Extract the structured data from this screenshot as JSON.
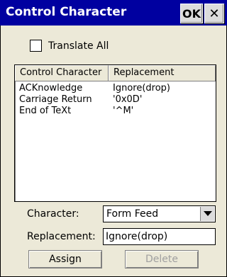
{
  "window": {
    "title": "Control Character",
    "ok_label": "OK",
    "close_glyph": "✕"
  },
  "translate_all": {
    "label": "Translate All",
    "checked": false
  },
  "list": {
    "headers": [
      "Control Character",
      "Replacement"
    ],
    "rows": [
      {
        "character": "ACKnowledge",
        "replacement": "Ignore(drop)"
      },
      {
        "character": "Carriage Return",
        "replacement": "'0x0D'"
      },
      {
        "character": "End of TeXt",
        "replacement": "'^M'"
      }
    ]
  },
  "character_field": {
    "label": "Character:",
    "value": "Form Feed"
  },
  "replacement_field": {
    "label": "Replacement:",
    "value": "Ignore(drop)"
  },
  "buttons": {
    "assign": "Assign",
    "delete": "Delete"
  },
  "colors": {
    "titlebar": "#0000a0",
    "dialog_bg": "#ece9d8",
    "disabled_text": "#a0a0a0"
  }
}
